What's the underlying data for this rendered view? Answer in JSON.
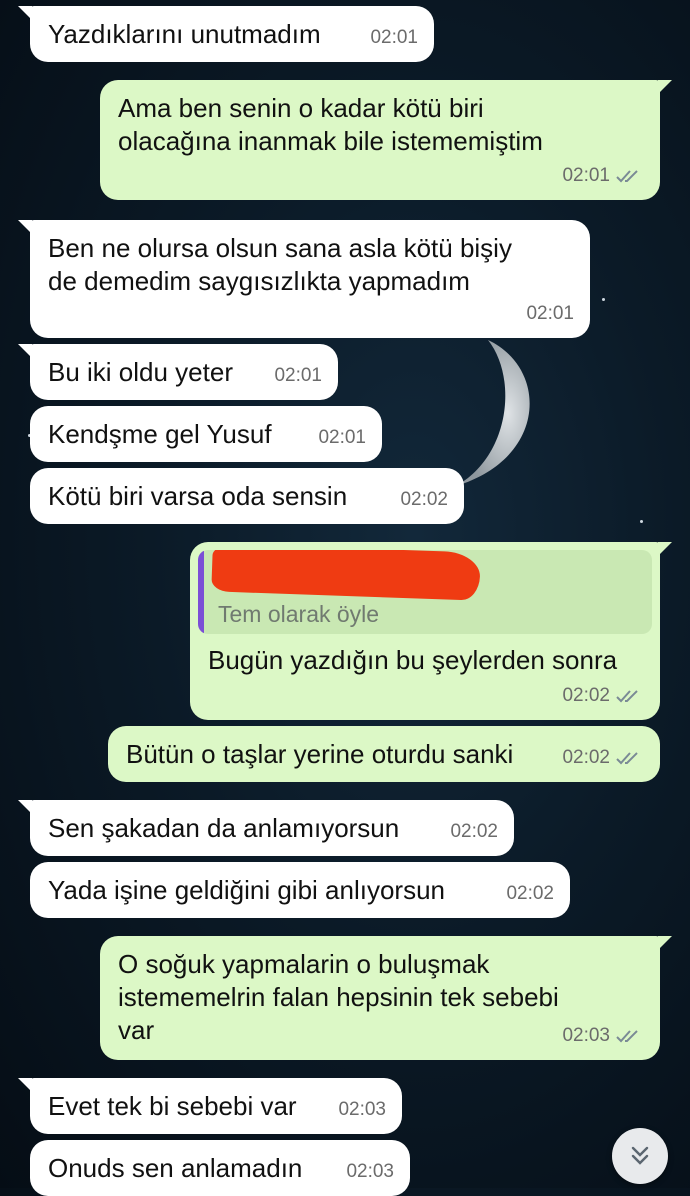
{
  "colors": {
    "incoming_bubble": "#ffffff",
    "outgoing_bubble": "#dcf8c6",
    "read_ticks": "#7a8a95",
    "quote_accent": "#7b4fd6",
    "redaction": "#ef3b12"
  },
  "messages": [
    {
      "text": "Yazdıklarını unutmadım",
      "time": "02:01",
      "direction": "in"
    },
    {
      "text": "Ama ben senin o kadar kötü biri\nolacağına inanmak bile istememiştim",
      "time": "02:01",
      "direction": "out",
      "ticks": "double-check-icon"
    },
    {
      "text": "Ben ne olursa olsun sana asla kötü bişiy\nde demedim saygısızlıkta yapmadım",
      "time": "02:01",
      "direction": "in"
    },
    {
      "text": "Bu iki oldu yeter",
      "time": "02:01",
      "direction": "in"
    },
    {
      "text": "Kendşme gel Yusuf",
      "time": "02:01",
      "direction": "in"
    },
    {
      "text": "Kötü biri varsa oda sensin",
      "time": "02:02",
      "direction": "in"
    },
    {
      "text": "Bugün yazdığın bu şeylerden sonra",
      "time": "02:02",
      "direction": "out",
      "ticks": "double-check-icon",
      "quote": {
        "text": "Tem olarak öyle"
      }
    },
    {
      "text": "Bütün o taşlar yerine oturdu sanki",
      "time": "02:02",
      "direction": "out",
      "ticks": "double-check-icon"
    },
    {
      "text": "Sen şakadan da anlamıyorsun",
      "time": "02:02",
      "direction": "in"
    },
    {
      "text": "Yada işine geldiğini gibi anlıyorsun",
      "time": "02:02",
      "direction": "in"
    },
    {
      "text": "O soğuk yapmalarin o buluşmak\nistememelrin falan hepsinin tek sebebi\nvar",
      "time": "02:03",
      "direction": "out",
      "ticks": "double-check-icon"
    },
    {
      "text": "Evet tek bi sebebi var",
      "time": "02:03",
      "direction": "in"
    },
    {
      "text": "Onuds sen anlamadın",
      "time": "02:03",
      "direction": "in"
    }
  ],
  "scroll_button": {
    "icon": "double-chevron-down-icon"
  }
}
